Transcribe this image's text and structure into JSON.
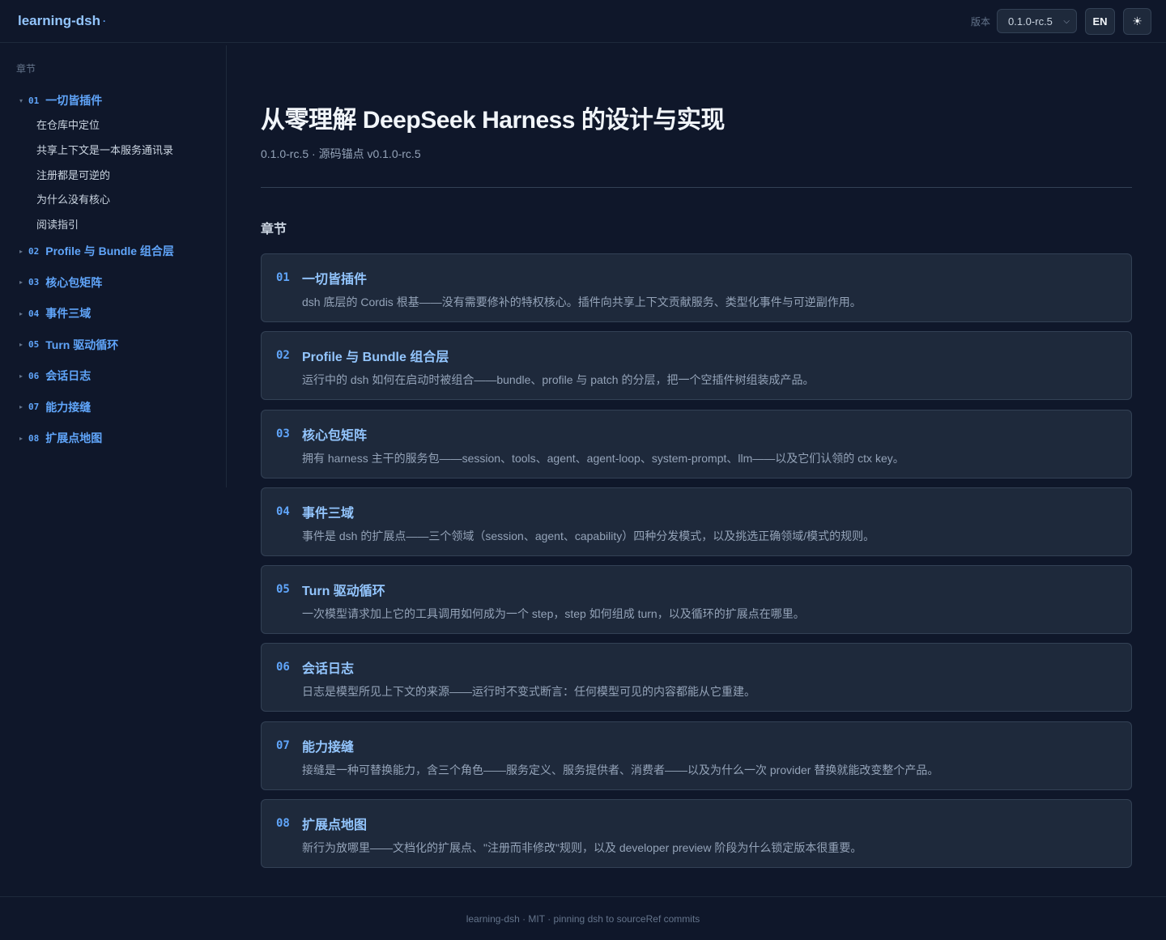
{
  "header": {
    "brand": "learning-dsh",
    "brand_dot": "·",
    "version_label": "版本",
    "version_value": "0.1.0-rc.5",
    "lang_button": "EN",
    "theme_icon": "sun-icon",
    "theme_glyph": "☀"
  },
  "sidebar": {
    "heading": "章节",
    "chapters": [
      {
        "num": "01",
        "label": "一切皆插件",
        "expanded": true
      },
      {
        "num": "02",
        "label": "Profile 与 Bundle 组合层"
      },
      {
        "num": "03",
        "label": "核心包矩阵"
      },
      {
        "num": "04",
        "label": "事件三域"
      },
      {
        "num": "05",
        "label": "Turn 驱动循环"
      },
      {
        "num": "06",
        "label": "会话日志"
      },
      {
        "num": "07",
        "label": "能力接缝"
      },
      {
        "num": "08",
        "label": "扩展点地图"
      }
    ],
    "subitems": [
      "在仓库中定位",
      "共享上下文是一本服务通讯录",
      "注册都是可逆的",
      "为什么没有核心",
      "阅读指引"
    ]
  },
  "main": {
    "title": "从零理解 DeepSeek Harness 的设计与实现",
    "subtitle": "0.1.0-rc.5 · 源码锚点 v0.1.0-rc.5",
    "section_title": "章节",
    "cards": [
      {
        "num": "01",
        "title": "一切皆插件",
        "desc": "dsh 底层的 Cordis 根基——没有需要修补的特权核心。插件向共享上下文贡献服务、类型化事件与可逆副作用。"
      },
      {
        "num": "02",
        "title": "Profile 与 Bundle 组合层",
        "desc": "运行中的 dsh 如何在启动时被组合——bundle、profile 与 patch 的分层，把一个空插件树组装成产品。"
      },
      {
        "num": "03",
        "title": "核心包矩阵",
        "desc": "拥有 harness 主干的服务包——session、tools、agent、agent-loop、system-prompt、llm——以及它们认领的 ctx key。"
      },
      {
        "num": "04",
        "title": "事件三域",
        "desc": "事件是 dsh 的扩展点——三个领域（session、agent、capability）四种分发模式，以及挑选正确领域/模式的规则。"
      },
      {
        "num": "05",
        "title": "Turn 驱动循环",
        "desc": "一次模型请求加上它的工具调用如何成为一个 step，step 如何组成 turn，以及循环的扩展点在哪里。"
      },
      {
        "num": "06",
        "title": "会话日志",
        "desc": "日志是模型所见上下文的来源——运行时不变式断言：任何模型可见的内容都能从它重建。"
      },
      {
        "num": "07",
        "title": "能力接缝",
        "desc": "接缝是一种可替换能力，含三个角色——服务定义、服务提供者、消费者——以及为什么一次 provider 替换就能改变整个产品。"
      },
      {
        "num": "08",
        "title": "扩展点地图",
        "desc": "新行为放哪里——文档化的扩展点、\"注册而非修改\"规则，以及 developer preview 阶段为什么锁定版本很重要。"
      }
    ]
  },
  "footer": {
    "text": "learning-dsh · MIT · pinning dsh to sourceRef commits"
  }
}
